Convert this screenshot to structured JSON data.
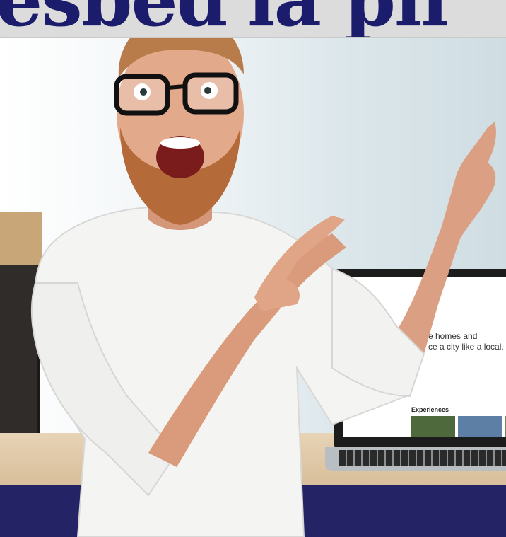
{
  "banner": {
    "text": "esbed'la pli"
  },
  "laptop_screen": {
    "hero_line1": "e homes and",
    "hero_line2": "ce a city like a local.",
    "section_heading": "Experiences"
  },
  "colors": {
    "banner_text": "#1b1c6b",
    "bottom_bar": "#232366",
    "shirt": "#f4f4f2",
    "beard": "#b56a3a"
  }
}
